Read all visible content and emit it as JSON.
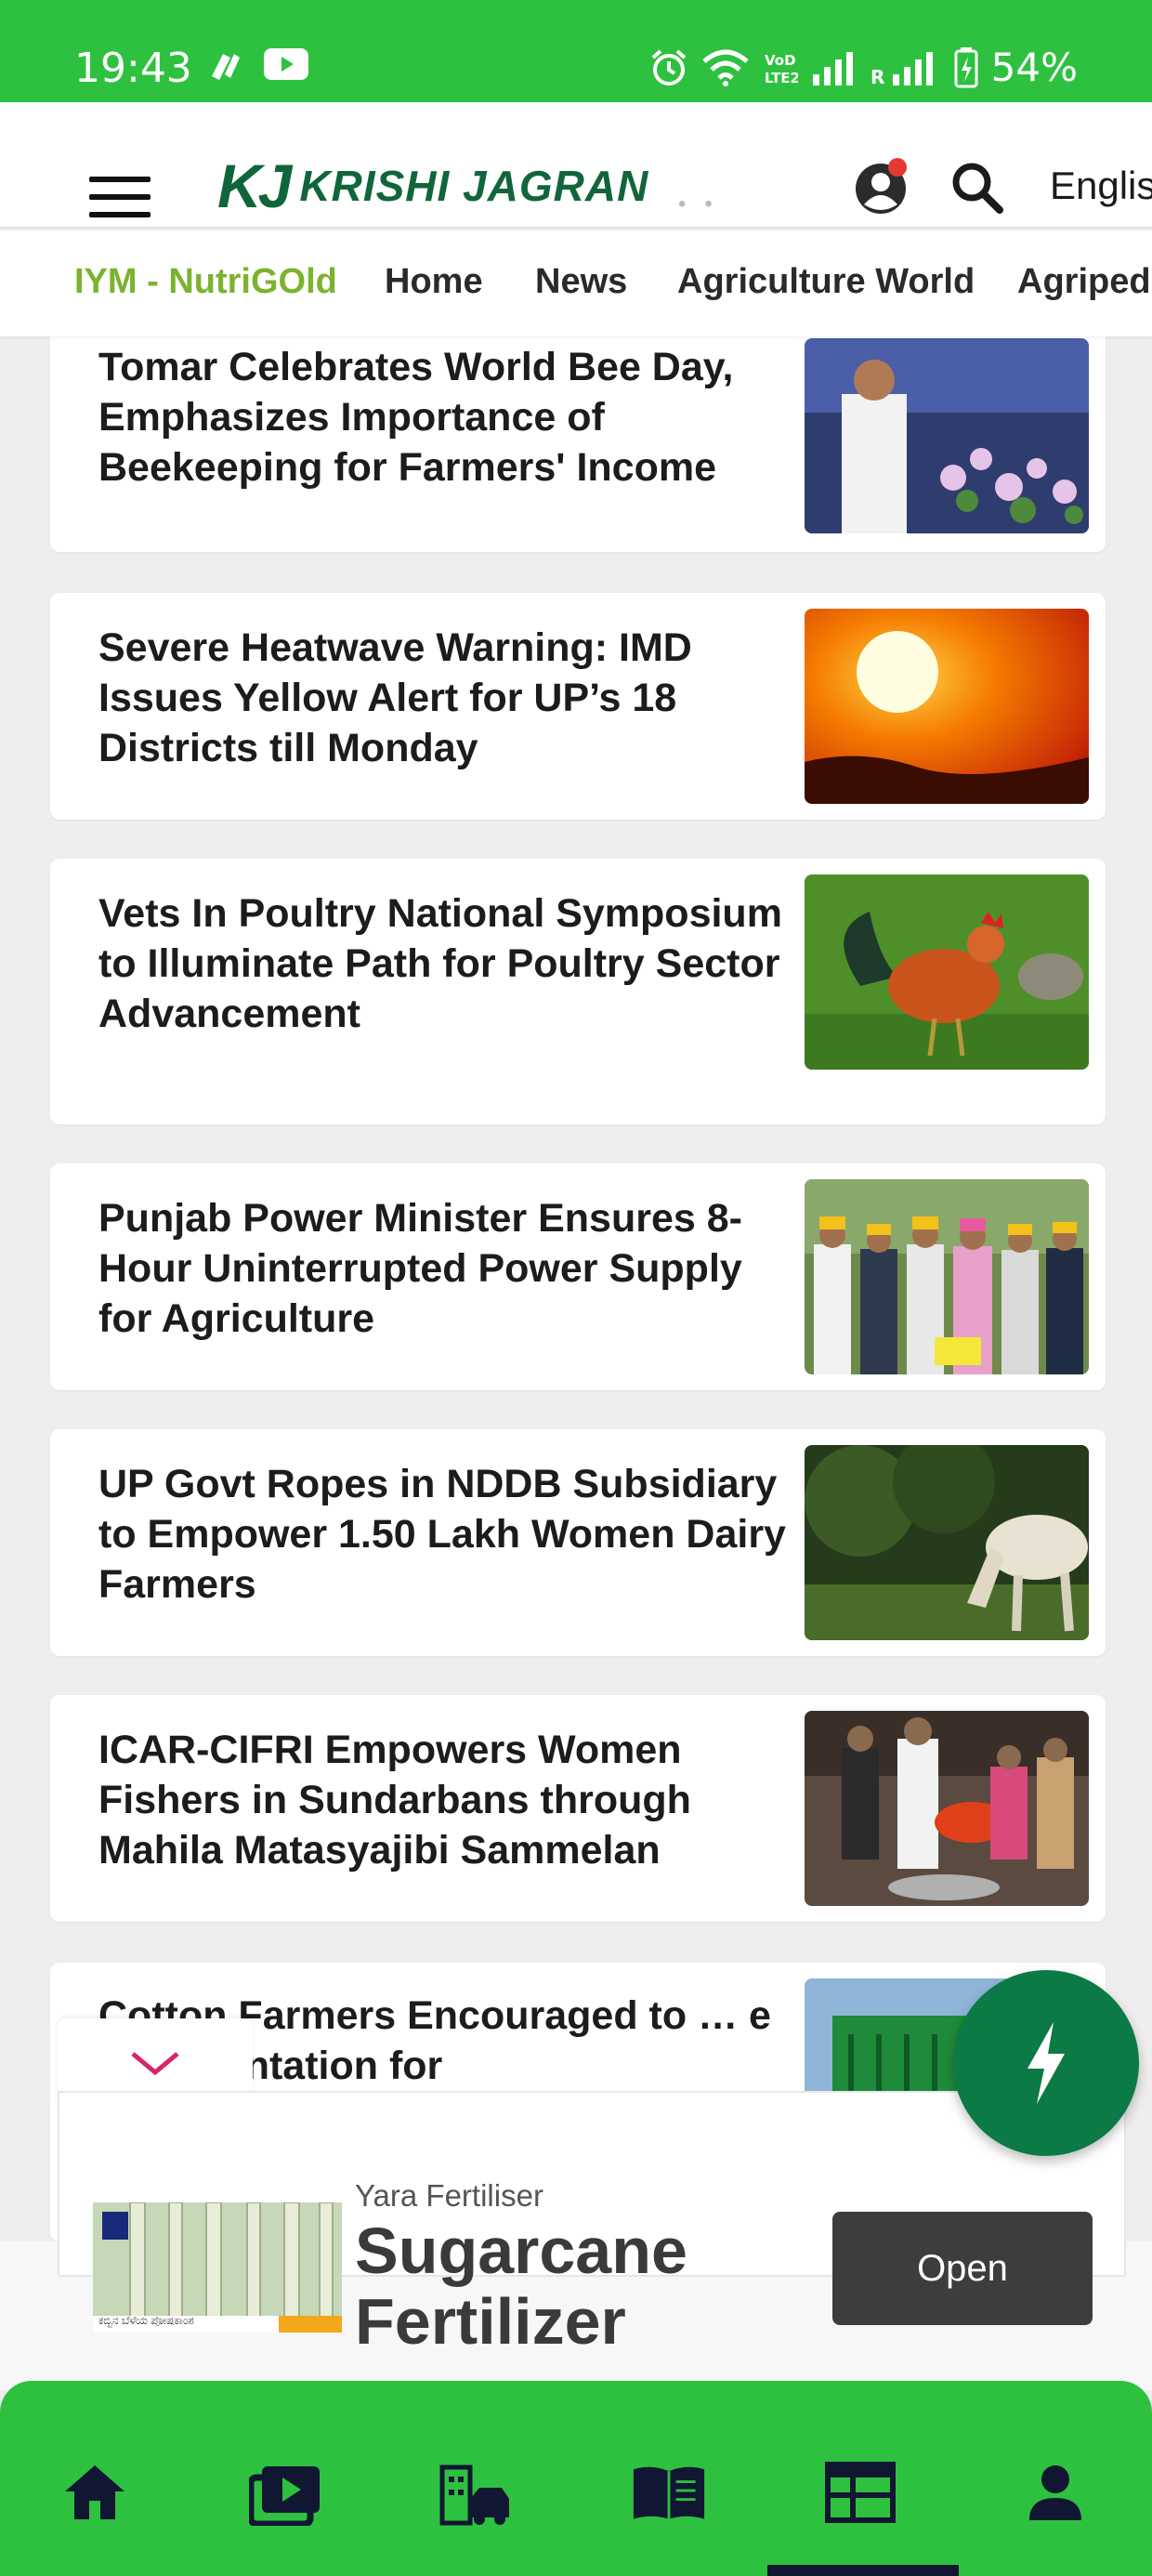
{
  "status_bar": {
    "time": "19:43",
    "battery": "54%",
    "icons": [
      "pinwheel-icon",
      "youtube-icon",
      "alarm-icon",
      "wifi-icon",
      "volte-icon",
      "signal-icon",
      "roaming-signal-icon",
      "battery-icon"
    ]
  },
  "header": {
    "logo_mark": "KJ",
    "logo_text": "KRISHI JAGRAN",
    "language": "English",
    "has_notification": true
  },
  "nav": {
    "tabs": [
      {
        "label": "IYM - NutriGOld",
        "accent": true
      },
      {
        "label": "Home"
      },
      {
        "label": "News"
      },
      {
        "label": "Agriculture World"
      },
      {
        "label": "Agripedia"
      }
    ]
  },
  "articles": [
    {
      "title": "Tomar Celebrates World Bee Day, Emphasizes Importance of Beekeeping for Farmers' Income",
      "image": "minister-flowers-photo"
    },
    {
      "title": "Severe Heatwave Warning: IMD Issues Yellow Alert for UP’s 18 Districts till Monday",
      "image": "sun-heat-photo"
    },
    {
      "title": "Vets In Poultry National Symposium to Illuminate Path for Poultry Sector Advancement",
      "image": "rooster-photo"
    },
    {
      "title": "Punjab Power Minister Ensures 8-Hour Uninterrupted Power Supply for Agriculture",
      "image": "group-turbans-photo"
    },
    {
      "title": "UP Govt Ropes in NDDB Subsidiary to Empower 1.50 Lakh Women Dairy Farmers",
      "image": "cow-grazing-photo"
    },
    {
      "title": "ICAR-CIFRI Empowers Women Fishers in Sundarbans through Mahila Matasyajibi Sammelan",
      "image": "fish-distribution-photo"
    },
    {
      "title": "Cotton Farmers Encouraged to … e Bed Plantation for",
      "image": "tractor-photo"
    }
  ],
  "ad": {
    "sponsor": "Yara Fertiliser",
    "headline": "Sugarcane Fertilizer",
    "cta": "Open",
    "image_caption": "ಕಬ್ಬಿನ ಬೆಳೆಯ ಪೋಷಕಾಂಶ",
    "collapse_icon": "chevron-down-icon"
  },
  "fab": {
    "icon": "lightning-icon"
  },
  "bottom_nav": {
    "items": [
      "home-icon",
      "video-icon",
      "city-icon",
      "magazine-icon",
      "news-feed-icon",
      "account-icon"
    ],
    "active_index": 4
  },
  "colors": {
    "brand_green": "#2ec13f",
    "logo_green": "#10663a",
    "fab_green": "#0b7a45",
    "accent_tab": "#7bb32e",
    "icon_navy": "#111633"
  }
}
